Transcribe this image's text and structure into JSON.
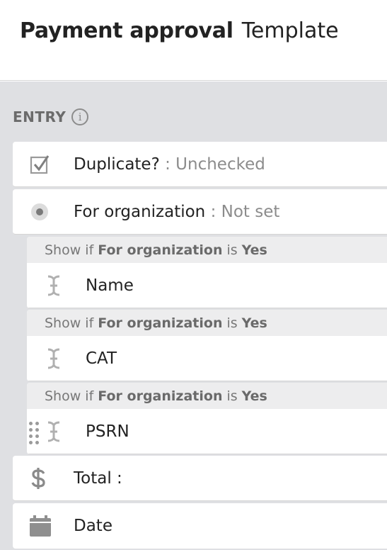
{
  "header": {
    "title": "Payment approval",
    "subtitle": "Template"
  },
  "section": {
    "label": "ENTRY",
    "info_glyph": "i"
  },
  "fields": {
    "duplicate": {
      "label": "Duplicate?",
      "sep": " : ",
      "value": "Unchecked",
      "icon": "checkbox-checked-icon"
    },
    "for_org": {
      "label": "For organization",
      "sep": " : ",
      "value": "Not set",
      "icon": "radio-icon"
    },
    "total": {
      "label": "Total :",
      "icon": "dollar-icon"
    },
    "date": {
      "label": "Date",
      "icon": "calendar-icon"
    }
  },
  "conditional": {
    "prefix": "Show if",
    "field": "For organization",
    "op": "is",
    "value": "Yes",
    "items": [
      {
        "label": "Name"
      },
      {
        "label": "CAT"
      },
      {
        "label": "PSRN"
      }
    ]
  },
  "colors": {
    "panel_bg": "#dfe0e3",
    "icon_gray": "#8c8c8c",
    "muted_text": "#8c8c8c"
  }
}
